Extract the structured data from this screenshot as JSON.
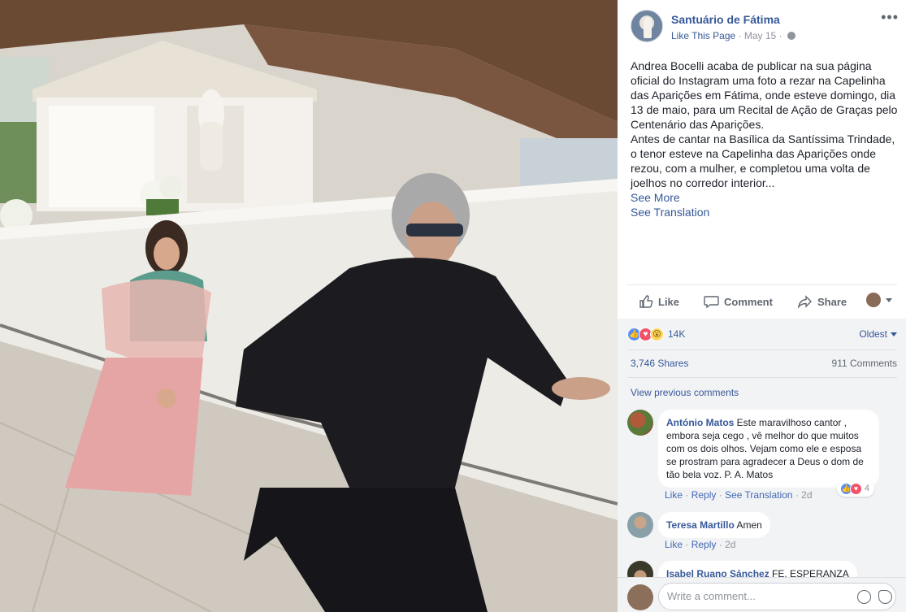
{
  "post": {
    "page_name": "Santuário de Fátima",
    "like_page": "Like This Page",
    "date": "May 15",
    "more_label": "•••",
    "text_p1": "Andrea Bocelli acaba de publicar na sua página oficial do Instagram uma foto a rezar na Capelinha das Aparições em Fátima, onde esteve domingo, dia 13 de maio, para um Recital de Ação de Graças pelo Centenário das Aparições.",
    "text_p2": "Antes de cantar na Basílica da Santíssima Trindade, o tenor esteve na Capelinha das Aparições onde rezou, com a mulher, e completou uma volta de joelhos no corredor interior...",
    "see_more": "See More",
    "see_translation": "See Translation"
  },
  "actions": {
    "like": "Like",
    "comment": "Comment",
    "share": "Share"
  },
  "stats": {
    "reaction_count": "14K",
    "sort_label": "Oldest",
    "shares": "3,746 Shares",
    "comments": "911 Comments",
    "view_previous": "View previous comments"
  },
  "comments": [
    {
      "name": "António Matos",
      "text": "Este maravilhoso cantor , embora seja cego , vê melhor do que muitos com os dois olhos. Vejam como ele e esposa se prostram para agradecer a Deus o dom de tão bela voz. P. A. Matos",
      "like": "Like",
      "reply": "Reply",
      "see_translation": "See Translation",
      "time": "2d",
      "reactions": "4"
    },
    {
      "name": "Teresa Martillo",
      "text": "Amen",
      "like": "Like",
      "reply": "Reply",
      "time": "2d"
    },
    {
      "name": "Isabel Ruano Sánchez",
      "text": "FE, ESPERANZA"
    }
  ],
  "composer": {
    "placeholder": "Write a comment..."
  },
  "icons": {
    "like": "thumbs-up-icon",
    "comment": "speech-bubble-icon",
    "share": "share-arrow-icon",
    "emoji": "smiley-icon",
    "sticker": "sticker-icon"
  },
  "colors": {
    "link": "#365899",
    "secondary_text": "#90949c",
    "panel_gray": "#f2f3f5",
    "like_blue": "#5890ff",
    "love_red": "#f25268"
  }
}
